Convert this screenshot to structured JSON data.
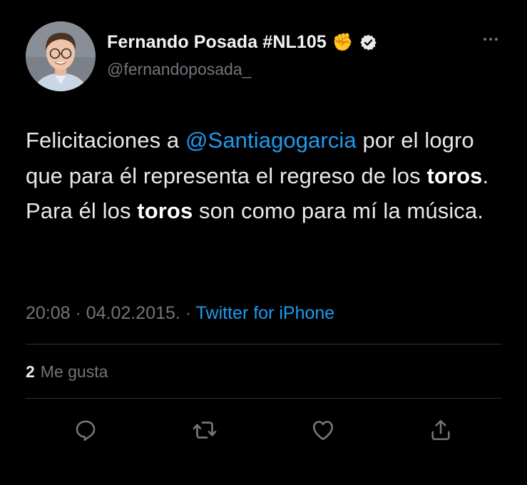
{
  "author": {
    "display_name": "Fernando Posada #NL105",
    "emoji": "✊",
    "handle": "@fernandoposada_"
  },
  "tweet": {
    "seg1": "Felicitaciones a ",
    "mention": "@Santiagogarcia",
    "seg2": " por el logro que para él representa el regreso de los ",
    "bold1": "toros",
    "seg3": ". Para él los ",
    "bold2": "toros",
    "seg4": " son como para mí la música."
  },
  "meta": {
    "time": "20:08",
    "date": "04.02.2015.",
    "sep": "·",
    "source": "Twitter for iPhone"
  },
  "likes": {
    "count": "2",
    "label": "Me gusta"
  },
  "icons": {
    "reply": "reply-icon",
    "retweet": "retweet-icon",
    "like": "heart-icon",
    "share": "share-icon",
    "verified": "verified-badge-icon",
    "more": "more-dots-icon"
  },
  "colors": {
    "background": "#000000",
    "link": "#1d9bf0",
    "secondary": "#71767b",
    "text": "#e7e9ea"
  }
}
